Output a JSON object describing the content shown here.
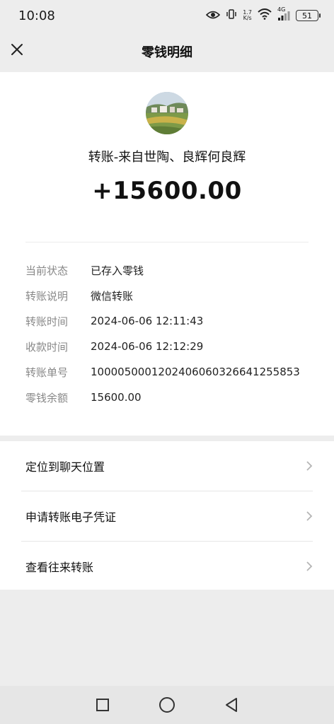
{
  "status_bar": {
    "time": "10:08",
    "network_speed_top": "1.7",
    "network_speed_bottom": "K/s",
    "network_type": "4G",
    "battery": "51",
    "icons": [
      "eye-icon",
      "vibrate-icon",
      "wifi-icon",
      "signal-icon",
      "battery-icon"
    ]
  },
  "nav": {
    "title": "零钱明细",
    "close_icon": "close-icon"
  },
  "detail": {
    "transfer_from": "转账-来自世陶、良辉何良辉",
    "amount": "+15600.00",
    "rows": [
      {
        "label": "当前状态",
        "value": "已存入零钱"
      },
      {
        "label": "转账说明",
        "value": "微信转账"
      },
      {
        "label": "转账时间",
        "value": "2024-06-06 12:11:43"
      },
      {
        "label": "收款时间",
        "value": "2024-06-06 12:12:29"
      },
      {
        "label": "转账单号",
        "value": "1000050001202406060326641255853"
      },
      {
        "label": "零钱余额",
        "value": "15600.00"
      }
    ]
  },
  "actions": [
    {
      "label": "定位到聊天位置"
    },
    {
      "label": "申请转账电子凭证"
    },
    {
      "label": "查看往来转账"
    }
  ],
  "system_nav": {
    "icons": [
      "recents-square-icon",
      "home-circle-icon",
      "back-triangle-icon"
    ]
  }
}
